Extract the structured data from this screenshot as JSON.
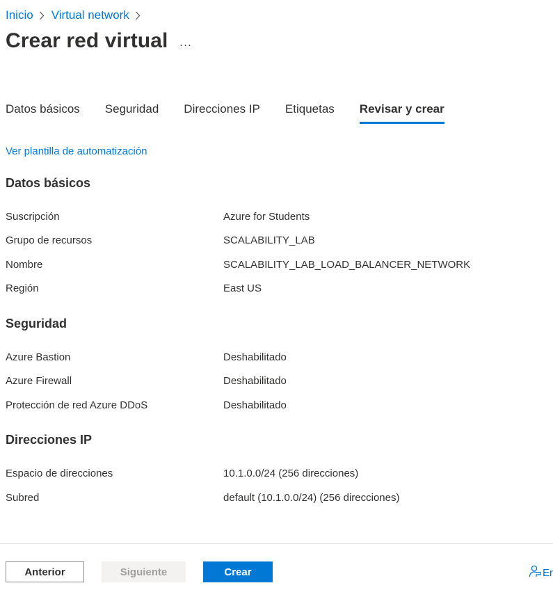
{
  "breadcrumb": {
    "items": [
      "Inicio",
      "Virtual network"
    ]
  },
  "page": {
    "title": "Crear red virtual",
    "more_label": "···"
  },
  "tabs": [
    {
      "label": "Datos básicos"
    },
    {
      "label": "Seguridad"
    },
    {
      "label": "Direcciones IP"
    },
    {
      "label": "Etiquetas"
    },
    {
      "label": "Revisar y crear",
      "active": true
    }
  ],
  "template_link": "Ver plantilla de automatización",
  "sections": {
    "basics": {
      "title": "Datos básicos",
      "rows": [
        {
          "label": "Suscripción",
          "value": "Azure for Students"
        },
        {
          "label": "Grupo de recursos",
          "value": "SCALABILITY_LAB"
        },
        {
          "label": "Nombre",
          "value": "SCALABILITY_LAB_LOAD_BALANCER_NETWORK"
        },
        {
          "label": "Región",
          "value": "East US"
        }
      ]
    },
    "security": {
      "title": "Seguridad",
      "rows": [
        {
          "label": "Azure Bastion",
          "value": "Deshabilitado"
        },
        {
          "label": "Azure Firewall",
          "value": "Deshabilitado"
        },
        {
          "label": "Protección de red Azure DDoS",
          "value": "Deshabilitado"
        }
      ]
    },
    "ip": {
      "title": "Direcciones IP",
      "rows": [
        {
          "label": "Espacio de direcciones",
          "value": "10.1.0.0/24 (256 direcciones)"
        },
        {
          "label": "Subred",
          "value": "default (10.1.0.0/24) (256 direcciones)"
        }
      ]
    }
  },
  "footer": {
    "prev_label": "Anterior",
    "next_label": "Siguiente",
    "create_label": "Crear",
    "feedback_label": "Er",
    "feedback_icon": "feedback-person-icon"
  },
  "colors": {
    "accent": "#0078d4",
    "text": "#323130",
    "disabled_bg": "#f3f2f1",
    "disabled_text": "#a19f9d"
  }
}
